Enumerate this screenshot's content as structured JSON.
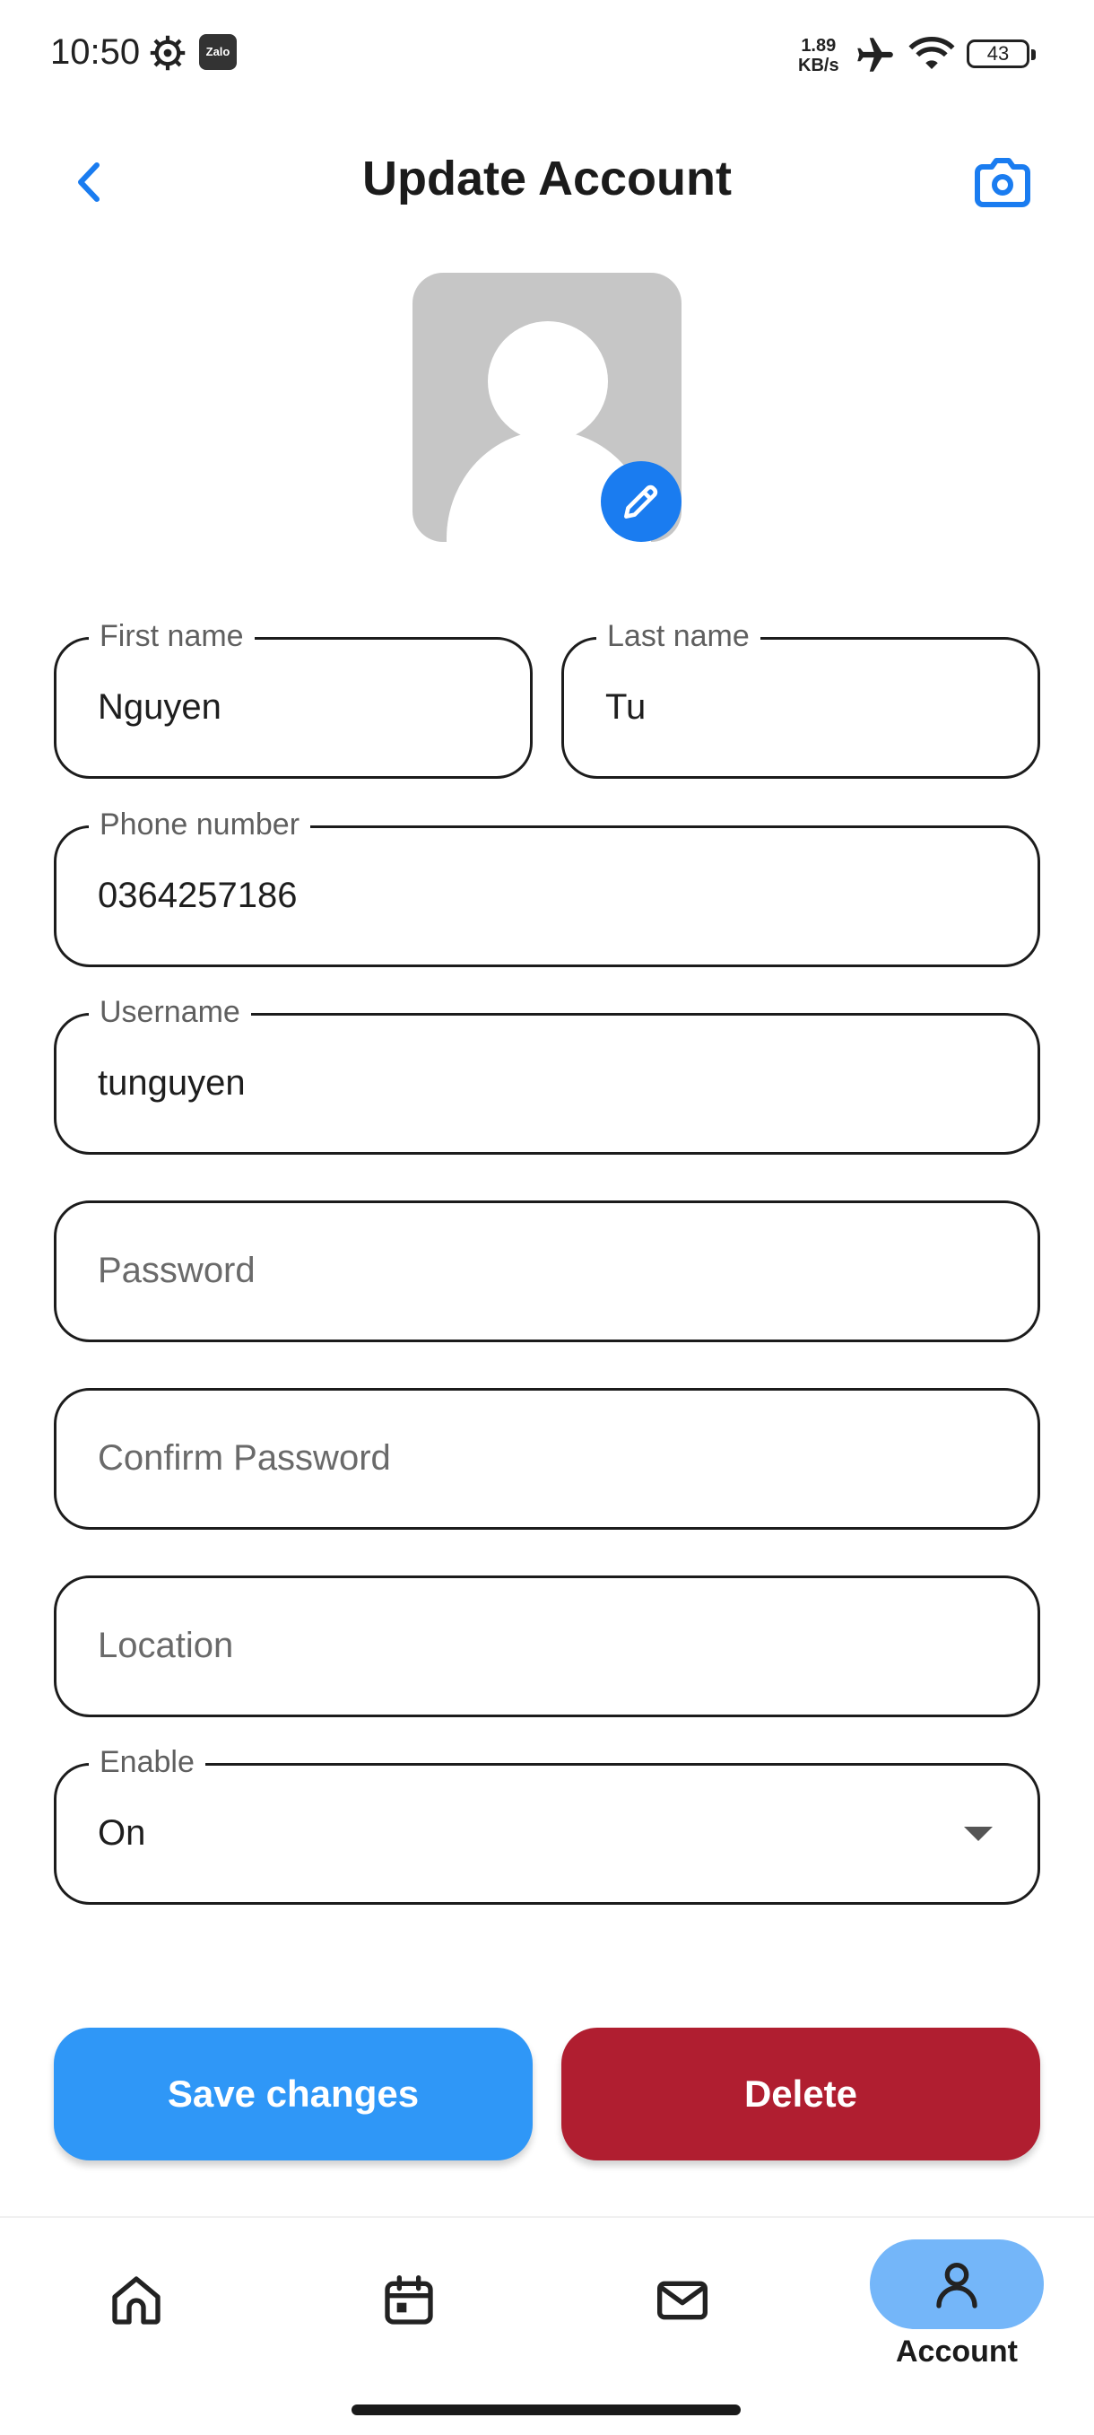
{
  "status_bar": {
    "time": "10:50",
    "net_speed_value": "1.89",
    "net_speed_unit": "KB/s",
    "battery": "43",
    "app_icon_text": "Zalo"
  },
  "header": {
    "title": "Update Account"
  },
  "form": {
    "first_name": {
      "label": "First name",
      "value": "Nguyen"
    },
    "last_name": {
      "label": "Last name",
      "value": "Tu"
    },
    "phone": {
      "label": "Phone number",
      "value": "0364257186"
    },
    "username": {
      "label": "Username",
      "value": "tunguyen"
    },
    "password": {
      "placeholder": "Password"
    },
    "confirm_password": {
      "placeholder": "Confirm Password"
    },
    "location": {
      "placeholder": "Location"
    },
    "enable": {
      "label": "Enable",
      "value": "On"
    }
  },
  "actions": {
    "save_label": "Save changes",
    "delete_label": "Delete"
  },
  "bottom_nav": {
    "items": [
      "home-icon",
      "calendar-icon",
      "mail-icon",
      "account-icon"
    ],
    "active_label": "Account"
  },
  "colors": {
    "primary": "#2f97f7",
    "danger": "#b01e30",
    "accent_icon": "#1a7cf0",
    "nav_active": "#74b6f9"
  }
}
